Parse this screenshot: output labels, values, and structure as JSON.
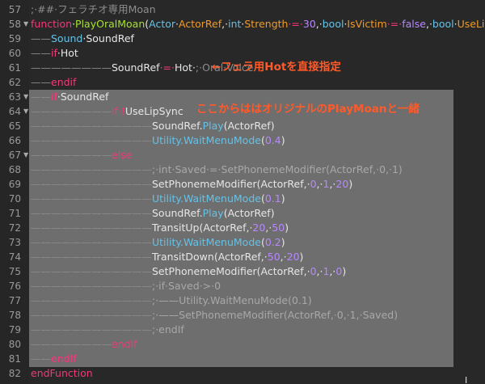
{
  "editor": {
    "lines": [
      {
        "num": "57",
        "fold": "",
        "indent": "",
        "tokens": [
          {
            "t": ";·##·フェラチオ専用Moan",
            "c": "comment"
          }
        ]
      },
      {
        "num": "58",
        "fold": "▼",
        "indent": "",
        "tokens": [
          {
            "t": "function",
            "c": "kw"
          },
          {
            "t": "·"
          },
          {
            "t": "PlayOralMoan",
            "c": "fn"
          },
          {
            "t": "("
          },
          {
            "t": "Actor",
            "c": "type"
          },
          {
            "t": "·"
          },
          {
            "t": "ActorRef",
            "c": "param"
          },
          {
            "t": ",·"
          },
          {
            "t": "int",
            "c": "type"
          },
          {
            "t": "·"
          },
          {
            "t": "Strength",
            "c": "param"
          },
          {
            "t": "·=·",
            "c": "op"
          },
          {
            "t": "30",
            "c": "num"
          },
          {
            "t": ",·"
          },
          {
            "t": "bool",
            "c": "type"
          },
          {
            "t": "·"
          },
          {
            "t": "IsVictim",
            "c": "param"
          },
          {
            "t": "·=·",
            "c": "op"
          },
          {
            "t": "false",
            "c": "num"
          },
          {
            "t": ",·"
          },
          {
            "t": "bool",
            "c": "type"
          },
          {
            "t": "·"
          },
          {
            "t": "UseLipSync",
            "c": "param"
          }
        ]
      },
      {
        "num": "59",
        "fold": "",
        "indent": "——",
        "tokens": [
          {
            "t": "Sound",
            "c": "type"
          },
          {
            "t": "·SoundRef"
          }
        ]
      },
      {
        "num": "60",
        "fold": "",
        "indent": "——",
        "tokens": [
          {
            "t": "if",
            "c": "kw"
          },
          {
            "t": "·Hot"
          }
        ]
      },
      {
        "num": "61",
        "fold": "",
        "indent": "————————",
        "tokens": [
          {
            "t": "SoundRef"
          },
          {
            "t": "·=·",
            "c": "op"
          },
          {
            "t": "Hot·"
          },
          {
            "t": ";·Oral·Voice",
            "c": "comment"
          }
        ]
      },
      {
        "num": "62",
        "fold": "",
        "indent": "——",
        "tokens": [
          {
            "t": "endif",
            "c": "kw"
          }
        ]
      },
      {
        "num": "63",
        "fold": "▼",
        "indent": "——",
        "tokens": [
          {
            "t": "if",
            "c": "kw"
          },
          {
            "t": "·SoundRef"
          }
        ]
      },
      {
        "num": "64",
        "fold": "▼",
        "indent": "————————",
        "tokens": [
          {
            "t": "if",
            "c": "kw"
          },
          {
            "t": "·!",
            "c": "op"
          },
          {
            "t": "UseLipSync"
          }
        ]
      },
      {
        "num": "65",
        "fold": "",
        "indent": "————————————",
        "tokens": [
          {
            "t": "SoundRef."
          },
          {
            "t": "Play",
            "c": "call"
          },
          {
            "t": "(ActorRef)"
          }
        ]
      },
      {
        "num": "66",
        "fold": "",
        "indent": "————————————",
        "tokens": [
          {
            "t": "Utility.",
            "c": "call"
          },
          {
            "t": "WaitMenuMode",
            "c": "call"
          },
          {
            "t": "("
          },
          {
            "t": "0.4",
            "c": "num"
          },
          {
            "t": ")"
          }
        ]
      },
      {
        "num": "67",
        "fold": "▼",
        "indent": "————————",
        "tokens": [
          {
            "t": "else",
            "c": "kw"
          }
        ]
      },
      {
        "num": "68",
        "fold": "",
        "indent": "————————————",
        "tokens": [
          {
            "t": ";·int·Saved·=·SetPhonemeModifier(ActorRef,·0,·1)",
            "c": "comment-hl"
          }
        ]
      },
      {
        "num": "69",
        "fold": "",
        "indent": "————————————",
        "tokens": [
          {
            "t": "SetPhonemeModifier(ActorRef,·"
          },
          {
            "t": "0",
            "c": "num"
          },
          {
            "t": ",·"
          },
          {
            "t": "1",
            "c": "num"
          },
          {
            "t": ",·"
          },
          {
            "t": "20",
            "c": "num"
          },
          {
            "t": ")"
          }
        ]
      },
      {
        "num": "70",
        "fold": "",
        "indent": "————————————",
        "tokens": [
          {
            "t": "Utility.",
            "c": "call"
          },
          {
            "t": "WaitMenuMode",
            "c": "call"
          },
          {
            "t": "("
          },
          {
            "t": "0.1",
            "c": "num"
          },
          {
            "t": ")"
          }
        ]
      },
      {
        "num": "71",
        "fold": "",
        "indent": "————————————",
        "tokens": [
          {
            "t": "SoundRef."
          },
          {
            "t": "Play",
            "c": "call"
          },
          {
            "t": "(ActorRef)"
          }
        ]
      },
      {
        "num": "72",
        "fold": "",
        "indent": "————————————",
        "tokens": [
          {
            "t": "TransitUp(ActorRef,·"
          },
          {
            "t": "20",
            "c": "num"
          },
          {
            "t": ",·"
          },
          {
            "t": "50",
            "c": "num"
          },
          {
            "t": ")"
          }
        ]
      },
      {
        "num": "73",
        "fold": "",
        "indent": "————————————",
        "tokens": [
          {
            "t": "Utility.",
            "c": "call"
          },
          {
            "t": "WaitMenuMode",
            "c": "call"
          },
          {
            "t": "("
          },
          {
            "t": "0.2",
            "c": "num"
          },
          {
            "t": ")"
          }
        ]
      },
      {
        "num": "74",
        "fold": "",
        "indent": "————————————",
        "tokens": [
          {
            "t": "TransitDown(ActorRef,·"
          },
          {
            "t": "50",
            "c": "num"
          },
          {
            "t": ",·"
          },
          {
            "t": "20",
            "c": "num"
          },
          {
            "t": ")"
          }
        ]
      },
      {
        "num": "75",
        "fold": "",
        "indent": "————————————",
        "tokens": [
          {
            "t": "SetPhonemeModifier(ActorRef,·"
          },
          {
            "t": "0",
            "c": "num"
          },
          {
            "t": ",·"
          },
          {
            "t": "1",
            "c": "num"
          },
          {
            "t": ",·"
          },
          {
            "t": "0",
            "c": "num"
          },
          {
            "t": ")"
          }
        ]
      },
      {
        "num": "76",
        "fold": "",
        "indent": "————————————",
        "tokens": [
          {
            "t": ";·if·Saved·>·0",
            "c": "comment-hl"
          }
        ]
      },
      {
        "num": "77",
        "fold": "",
        "indent": "————————————",
        "tokens": [
          {
            "t": ";·——Utility.WaitMenuMode(0.1)",
            "c": "comment-hl"
          }
        ]
      },
      {
        "num": "78",
        "fold": "",
        "indent": "————————————",
        "tokens": [
          {
            "t": ";·——SetPhonemeModifier(ActorRef,·0,·1,·Saved)",
            "c": "comment-hl"
          }
        ]
      },
      {
        "num": "79",
        "fold": "",
        "indent": "————————————",
        "tokens": [
          {
            "t": ";·endIf",
            "c": "comment-hl"
          }
        ]
      },
      {
        "num": "80",
        "fold": "",
        "indent": "————————",
        "tokens": [
          {
            "t": "endIf",
            "c": "kw"
          }
        ]
      },
      {
        "num": "81",
        "fold": "",
        "indent": "——",
        "tokens": [
          {
            "t": "endIf",
            "c": "kw"
          }
        ]
      },
      {
        "num": "82",
        "fold": "",
        "indent": "",
        "tokens": [
          {
            "t": "endFunction",
            "c": "kw"
          }
        ]
      }
    ]
  },
  "annotations": {
    "hot_note": "←フェラ用Hotを直接指定",
    "block_note": "ここからははオリジナルのPlayMoanと一緒"
  },
  "cursor_glyph": "I",
  "colors": {
    "keyword": "#f2387a",
    "function": "#a6e22e",
    "type": "#63c2e8",
    "param": "#f09a28",
    "number": "#b887ff",
    "annotation": "#ff5a2a",
    "highlight": "#6e6e6e"
  }
}
